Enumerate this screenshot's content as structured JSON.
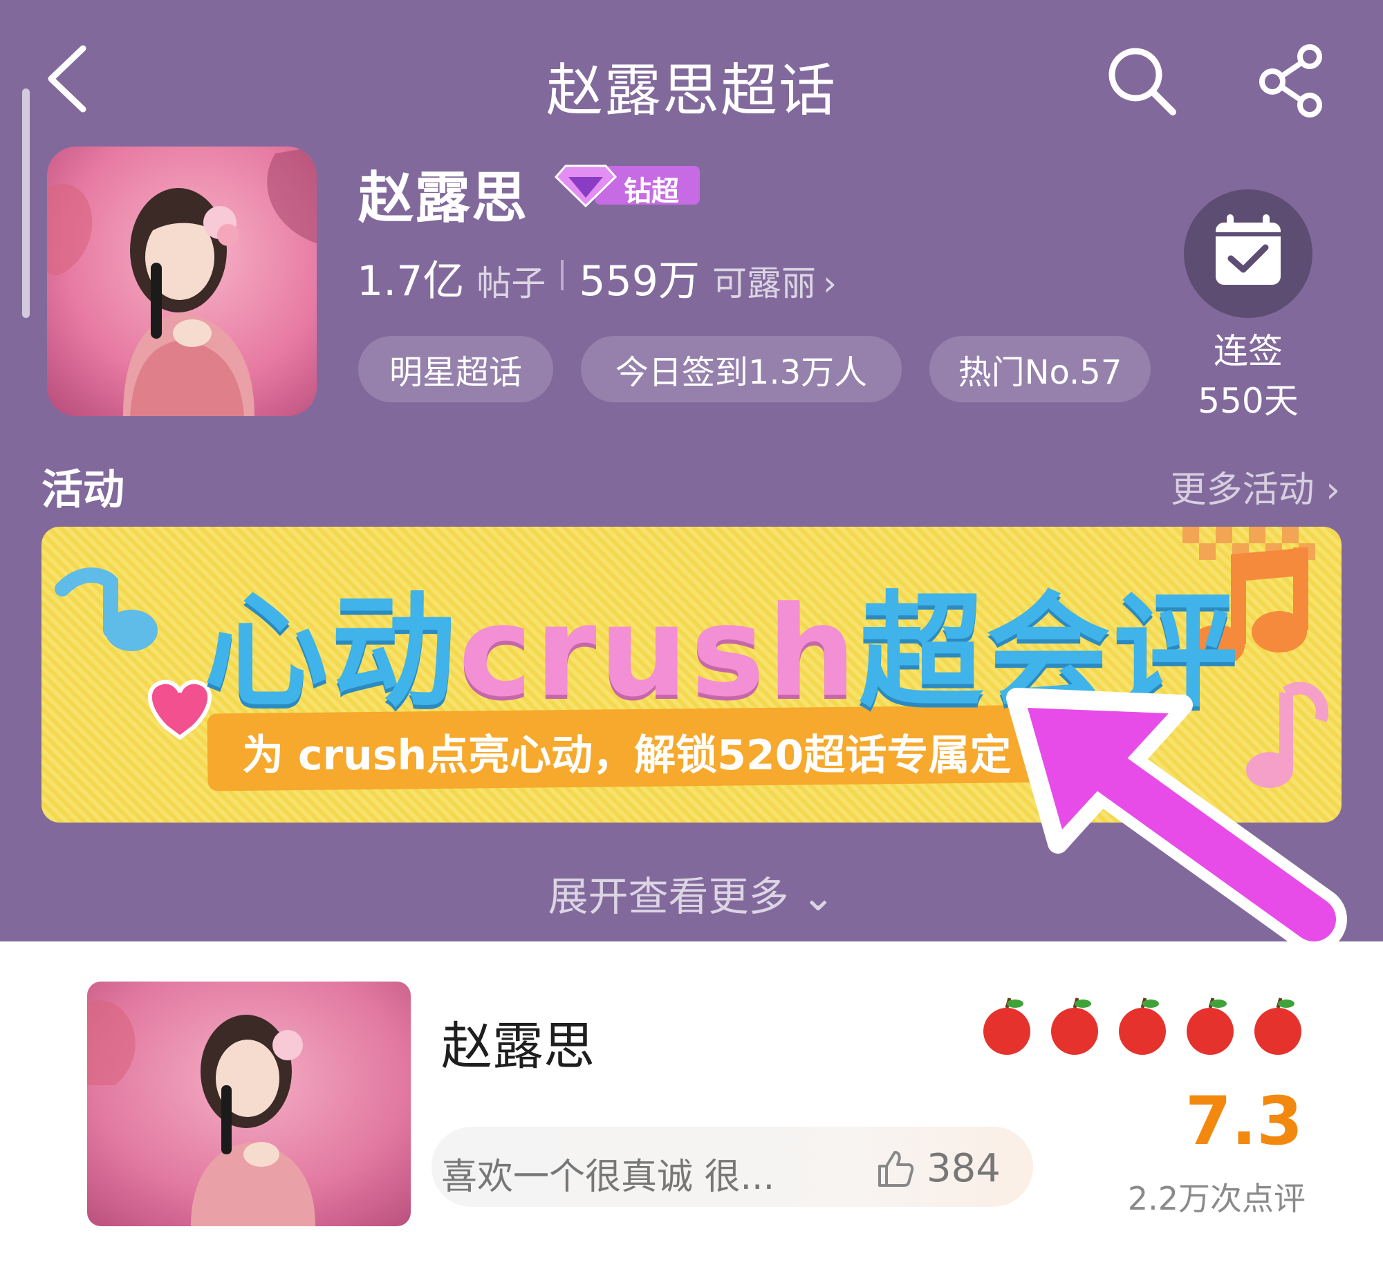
{
  "header": {
    "title": "赵露思超话"
  },
  "topic": {
    "name": "赵露思",
    "badge": "钻超",
    "posts_count": "1.7亿",
    "posts_label": "帖子",
    "fans_count": "559万",
    "fans_label": "可露丽",
    "tags": [
      "明星超话",
      "今日签到1.3万人",
      "热门No.57"
    ]
  },
  "checkin": {
    "line1": "连签",
    "line2": "550天"
  },
  "activity": {
    "section_title": "活动",
    "more_label": "更多活动",
    "banner": {
      "title_part1": "心动",
      "title_part2": "crush",
      "title_part3": "超会评",
      "subtitle": "为 crush点亮心动，解锁520超话专属定"
    },
    "expand_label": "展开查看更多"
  },
  "review_card": {
    "name": "赵露思",
    "rating_icons": [
      "apple-icon",
      "apple-icon",
      "apple-icon",
      "apple-icon",
      "apple-icon"
    ],
    "score": "7.3",
    "review_count": "2.2万次点评",
    "comment": "喜欢一个很真诚 很...",
    "likes": "384"
  },
  "colors": {
    "header_bg": "#82699c",
    "score": "#f3880f",
    "annotation_arrow": "#e84ce8"
  }
}
